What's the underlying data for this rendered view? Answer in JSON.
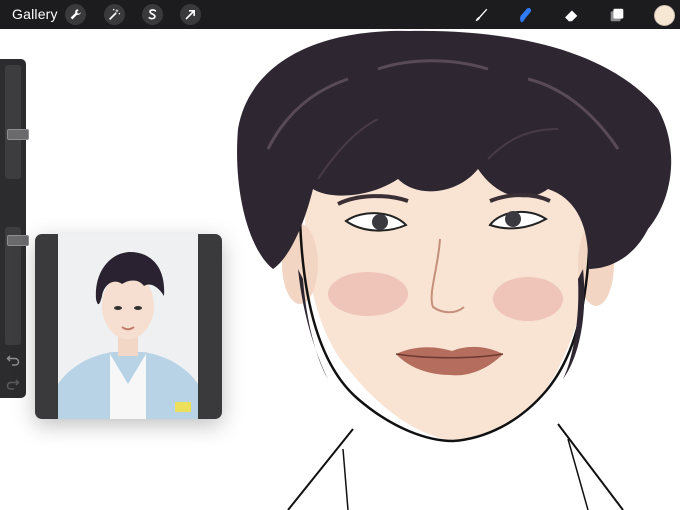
{
  "topbar": {
    "gallery_label": "Gallery",
    "left_tools": [
      "wrench-icon",
      "magic-wand-icon",
      "selection-icon",
      "transform-arrow-icon"
    ],
    "right_tools": [
      "brush-icon",
      "smudge-icon",
      "eraser-icon",
      "layers-icon"
    ],
    "active_tool": "smudge-icon",
    "active_color": "#f6e6d4",
    "accent": "#2f7cf6"
  },
  "sidebar": {
    "brush_size_level": 0.62,
    "opacity_level": 0.07
  },
  "reference": {
    "photo_watermark": "ON"
  },
  "colors": {
    "toolbar_bg": "#1c1c1e",
    "sidebar_bg": "#2c2c2e",
    "hair": "#2e2631",
    "skin": "#f9e4d4",
    "blush": "#e8a9a2",
    "lips": "#b56d5e"
  }
}
